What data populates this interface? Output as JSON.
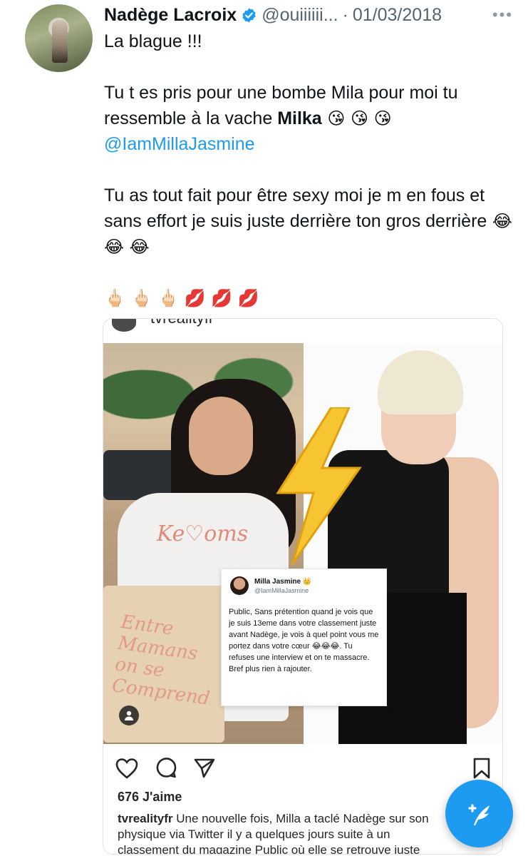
{
  "tweet": {
    "author_name": "Nadège Lacroix",
    "handle": "@ouiiiiii...",
    "separator": "·",
    "date": "01/03/2018",
    "more_label": "•••",
    "line1": "La blague !!!",
    "para2_text": "Tu t es pris pour une bombe Mila pour moi tu ressemble à la vache ",
    "para2_bold": "Milka",
    "para2_emojis": " 😘 😘 😘",
    "mention": "@IamMillaJasmine",
    "para3_text": "Tu as tout fait pour être sexy moi je m en fous et sans effort je suis juste derrière ton gros derrière",
    "para3_emojis": " 😂 😂 😂",
    "emoji_line": "🖕🏻 🖕🏻 🖕🏻 💋 💋 💋"
  },
  "instagram": {
    "username": "tvrealityfr",
    "shirt_text": "Ke♡oms",
    "tote_text": "Entre Mamans on se Comprend",
    "embedded_tweet": {
      "name": "Milla Jasmine 👑",
      "handle": "@IamMillaJasmine",
      "text": "Public, Sans prétention quand je vois que je suis 13eme dans votre classement juste avant Nadège, je vois à quel point vous me portez dans votre cœur 😂😂😂. Tu refuses une interview et on te massacre. Bref plus rien à rajouter."
    },
    "likes": "676 J'aime",
    "caption_user": "tvrealityfr",
    "caption_text": " Une nouvelle fois, Milla a taclé Nadège sur son physique via Twitter il y a quelques jours suite à un classement du magazine Public où elle se retrouve juste"
  },
  "colors": {
    "accent": "#1d9bf0",
    "secondary_text": "#536471",
    "verified": "#1d9bf0"
  },
  "icons": [
    "verified-badge-icon",
    "more-icon",
    "heart-icon",
    "comment-icon",
    "share-icon",
    "bookmark-icon",
    "profile-icon",
    "compose-icon",
    "lightning-icon"
  ]
}
